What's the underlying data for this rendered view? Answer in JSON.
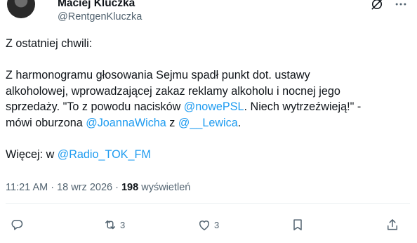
{
  "author": {
    "name": "Maciej Kluczka",
    "handle": "@RentgenKluczka"
  },
  "tweet": {
    "line1": "Z ostatniej chwili:",
    "line2": "Z harmonogramu głosowania Sejmu spadł punkt dot. ustawy",
    "line3": "alkoholowej, wprowadzającej zakaz reklamy alkoholu i nocnej jego",
    "line4a": "sprzedaży. \"To z powodu nacisków ",
    "mention1": "@nowePSL",
    "line4b": ". Niech wytrzeźwieją!\" -",
    "line5a": "mówi oburzona ",
    "mention2": "@JoannaWicha",
    "line5b": " z ",
    "mention3": "@__Lewica",
    "line5c": ".",
    "line6a": "Więcej: w ",
    "mention4": "@Radio_TOK_FM"
  },
  "meta": {
    "time": "11:21 AM",
    "separator1": " · ",
    "date": "18 wrz 2026",
    "separator2": " · ",
    "views_count": "198",
    "views_label": " wyświetleń"
  },
  "actions": {
    "reply_count": "",
    "retweet_count": "3",
    "like_count": "3"
  },
  "icons": {
    "grok": "grok-icon",
    "more": "more-icon",
    "reply": "reply-icon",
    "retweet": "retweet-icon",
    "like": "heart-icon",
    "bookmark": "bookmark-icon",
    "share": "share-icon"
  },
  "colors": {
    "text": "#0f1419",
    "secondary": "#536471",
    "link": "#1d9bf0",
    "divider": "#eff3f4"
  }
}
